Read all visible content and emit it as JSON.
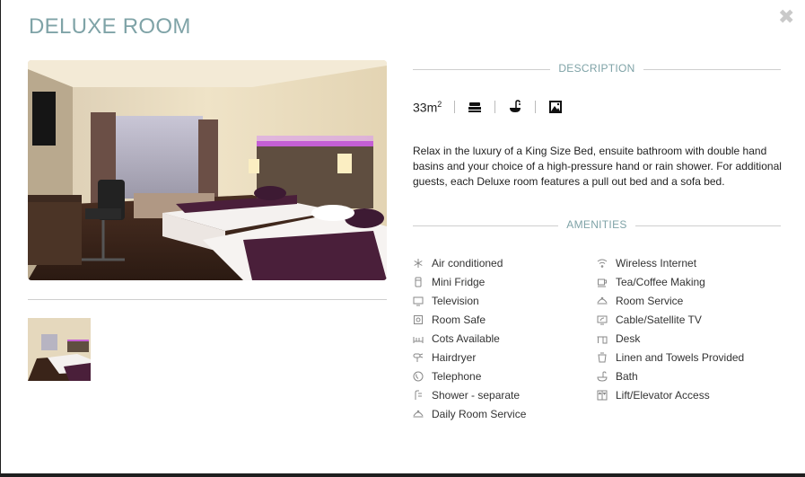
{
  "modal": {
    "title": "DELUXE ROOM",
    "close_glyph": "✖"
  },
  "description": {
    "heading": "DESCRIPTION",
    "size_value": "33m",
    "size_unit_sup": "2",
    "icons": [
      "bed-icon",
      "bath-icon",
      "picture-icon"
    ],
    "text": "Relax in the luxury of a King Size Bed, ensuite bathroom with double hand basins and your choice of a high-pressure hand or rain shower. For additional guests, each Deluxe room features a pull out bed and a sofa bed."
  },
  "amenities": {
    "heading": "AMENITIES",
    "left": [
      {
        "label": "Air conditioned",
        "icon": "snowflake-icon"
      },
      {
        "label": "Mini Fridge",
        "icon": "fridge-icon"
      },
      {
        "label": "Television",
        "icon": "tv-icon"
      },
      {
        "label": "Room Safe",
        "icon": "safe-icon"
      },
      {
        "label": "Cots Available",
        "icon": "cot-icon"
      },
      {
        "label": "Hairdryer",
        "icon": "hairdryer-icon"
      },
      {
        "label": "Telephone",
        "icon": "telephone-icon"
      },
      {
        "label": "Shower - separate",
        "icon": "shower-icon"
      },
      {
        "label": "Daily Room Service",
        "icon": "room-service-icon"
      }
    ],
    "right": [
      {
        "label": "Wireless Internet",
        "icon": "wifi-icon"
      },
      {
        "label": "Tea/Coffee Making",
        "icon": "coffee-icon"
      },
      {
        "label": "Room Service",
        "icon": "room-service-icon"
      },
      {
        "label": "Cable/Satellite TV",
        "icon": "satellite-tv-icon"
      },
      {
        "label": "Desk",
        "icon": "desk-icon"
      },
      {
        "label": "Linen and Towels Provided",
        "icon": "linen-icon"
      },
      {
        "label": "Bath",
        "icon": "bath-icon"
      },
      {
        "label": "Lift/Elevator Access",
        "icon": "elevator-icon"
      }
    ]
  },
  "colors": {
    "accent": "#7fa3a7",
    "divider": "#cfcfcf",
    "text": "#222222",
    "purple_accent": "#4a1f3a"
  }
}
